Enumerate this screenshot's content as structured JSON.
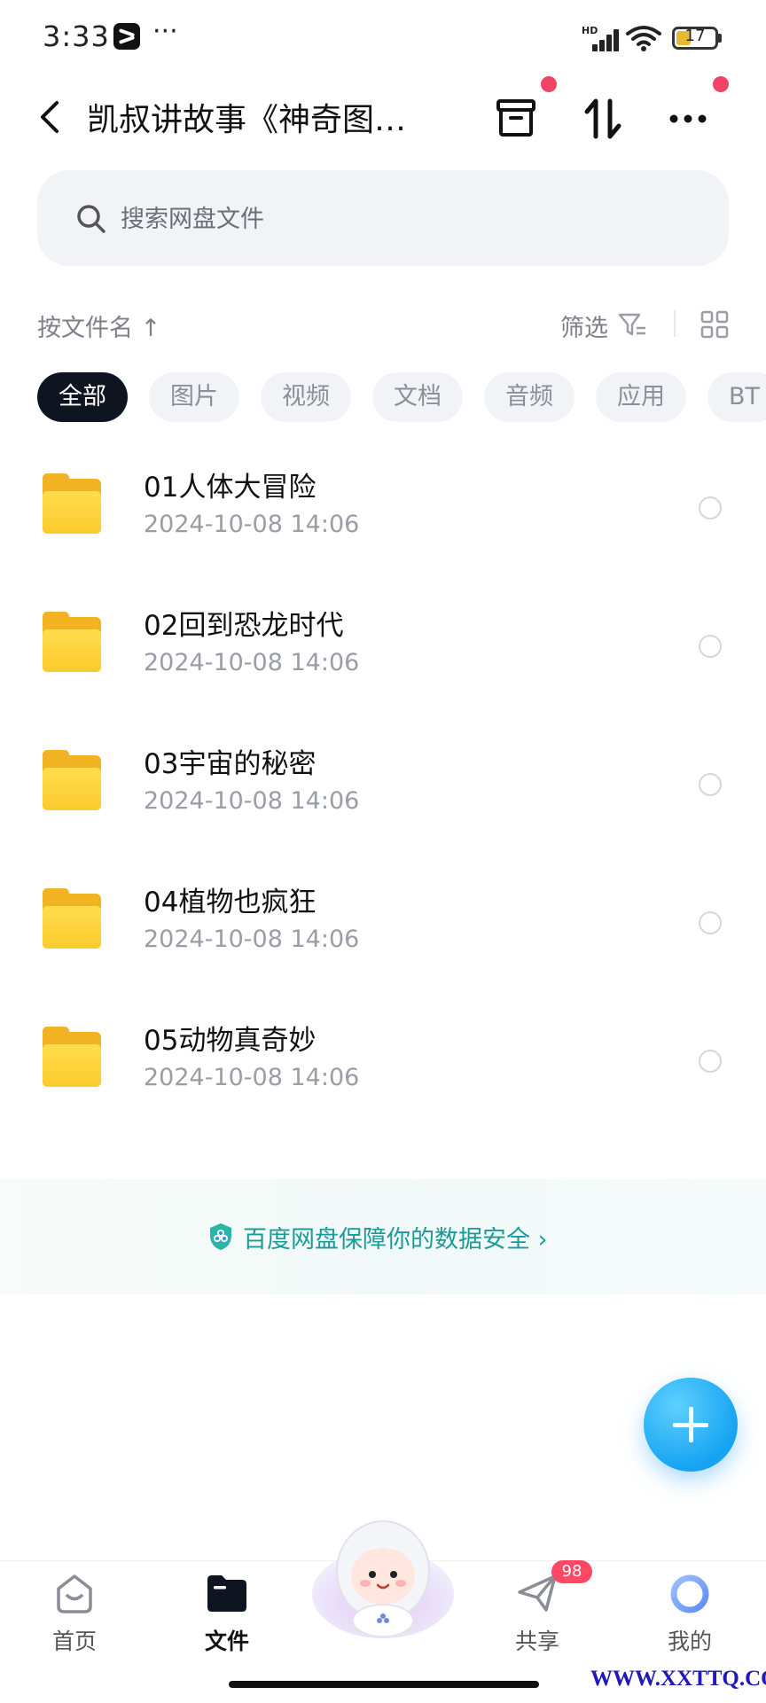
{
  "status_bar": {
    "time": "3:33",
    "more": "···",
    "network": "HD",
    "battery": "17"
  },
  "header": {
    "title": "凯叔讲故事《神奇图…",
    "back_icon": "chevron-left-icon",
    "icons": [
      "archive-box-icon",
      "sort-arrows-icon",
      "more-dots-icon"
    ]
  },
  "search": {
    "placeholder": "搜索网盘文件"
  },
  "toolbar": {
    "sort_label": "按文件名 ↑",
    "filter_label": "筛选"
  },
  "chips": [
    {
      "label": "全部",
      "active": true
    },
    {
      "label": "图片",
      "active": false
    },
    {
      "label": "视频",
      "active": false
    },
    {
      "label": "文档",
      "active": false
    },
    {
      "label": "音频",
      "active": false
    },
    {
      "label": "应用",
      "active": false
    },
    {
      "label": "BT",
      "active": false
    }
  ],
  "files": [
    {
      "name": "01人体大冒险",
      "date": "2024-10-08  14:06"
    },
    {
      "name": "02回到恐龙时代",
      "date": "2024-10-08  14:06"
    },
    {
      "name": "03宇宙的秘密",
      "date": "2024-10-08  14:06"
    },
    {
      "name": "04植物也疯狂",
      "date": "2024-10-08  14:06"
    },
    {
      "name": "05动物真奇妙",
      "date": "2024-10-08  14:06"
    }
  ],
  "security_banner": {
    "text": "百度网盘保障你的数据安全 ›"
  },
  "bottom_nav": {
    "items": [
      {
        "label": "首页",
        "icon": "home-face-icon"
      },
      {
        "label": "文件",
        "icon": "folder-icon",
        "active": true
      },
      {
        "label": "",
        "icon": "mascot-icon"
      },
      {
        "label": "共享",
        "icon": "paper-plane-icon",
        "badge": "98"
      },
      {
        "label": "我的",
        "icon": "profile-ring-icon"
      }
    ]
  },
  "watermark": "WWW.XXTTQ.COM",
  "colors": {
    "accent": "#16a4f2",
    "chip_active": "#0e1521",
    "folder": "#fbcb2c",
    "notification": "#f04464",
    "security_text": "#1c9a9a"
  }
}
